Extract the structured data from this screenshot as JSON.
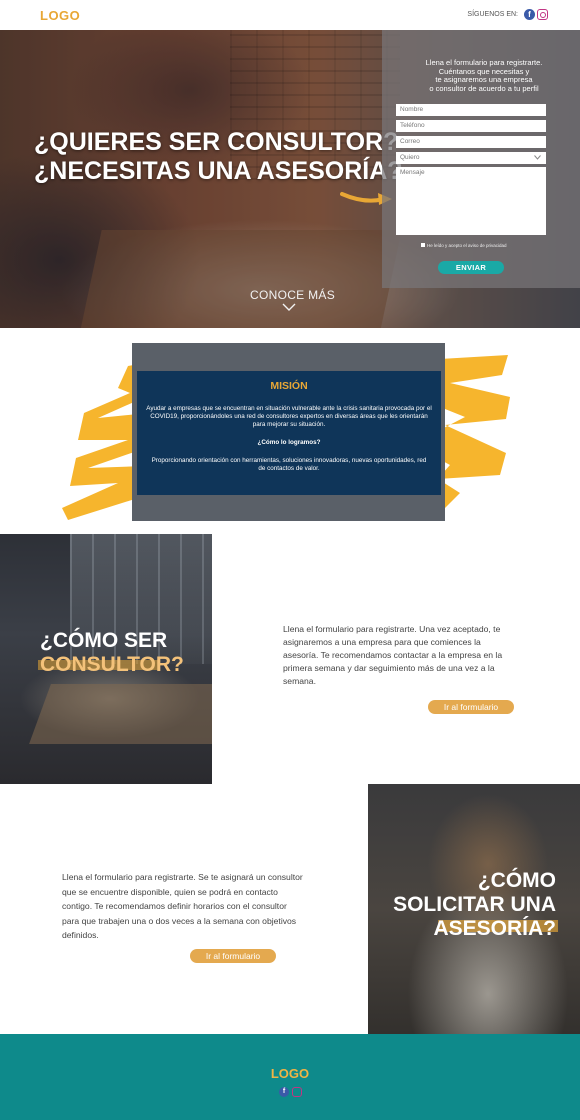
{
  "header": {
    "logo": "LOGO",
    "social_label": "SÍGUENOS EN:",
    "icons": [
      "facebook-icon",
      "instagram-icon"
    ]
  },
  "hero": {
    "title_line1": "¿QUIERES SER CONSULTOR?",
    "title_line2": "¿NECESITAS UNA ASESORÍA?",
    "scroll_label": "CONOCE MÁS",
    "form": {
      "intro_line1": "Llena el formulario para registrarte.",
      "intro_line2": "Cuéntanos que necesitas y",
      "intro_line3": "te asignaremos una empresa",
      "intro_line4": "o consultor de acuerdo a tu perfil",
      "name_placeholder": "Nombre",
      "phone_placeholder": "Teléfono",
      "email_placeholder": "Correo",
      "select_value": "Quiero",
      "message_placeholder": "Mensaje",
      "terms_label": "He leído y acepto el aviso de privacidad",
      "submit_label": "ENVIAR"
    }
  },
  "mission": {
    "title": "MISIÓN",
    "text": "Ayudar a empresas que se encuentran en situación vulnerable ante la crisis sanitaria provocada por el COVID19, proporcionándoles una red de consultores expertos en diversas áreas que les orientarán para mejorar su situación.",
    "subtitle": "¿Cómo lo logramos?",
    "text2": "Proporcionando orientación con herramientas, soluciones innovadoras, nuevas oportunidades, red de contactos de valor."
  },
  "consultant": {
    "title_line1": "¿CÓMO SER",
    "title_line2": "CONSULTOR?",
    "text": "Llena el formulario para registrarte. Una vez aceptado, te asignaremos a una empresa para que comiences la asesoría.  Te recomendamos contactar a la empresa en la primera semana y dar seguimiento más de una vez a la semana.",
    "button_label": "Ir al formulario"
  },
  "advice": {
    "title_line1": "¿CÓMO",
    "title_line2": "SOLICITAR UNA",
    "title_line3": "ASESORÍA?",
    "text": "Llena el formulario para registrarte. Se te asignará un consultor que se encuentre disponible, quien se podrá en contacto contigo. Te recomendamos definir horarios con el consultor para que trabajen una o dos veces a la semana con objetivos definidos.",
    "button_label": "Ir al formulario"
  },
  "footer": {
    "logo": "LOGO",
    "icons": [
      "facebook-icon",
      "instagram-icon"
    ]
  },
  "colors": {
    "accent": "#e8a735",
    "teal": "#1aa9a6",
    "footer": "#0e8a8b",
    "mission_bg": "#0f3559"
  }
}
